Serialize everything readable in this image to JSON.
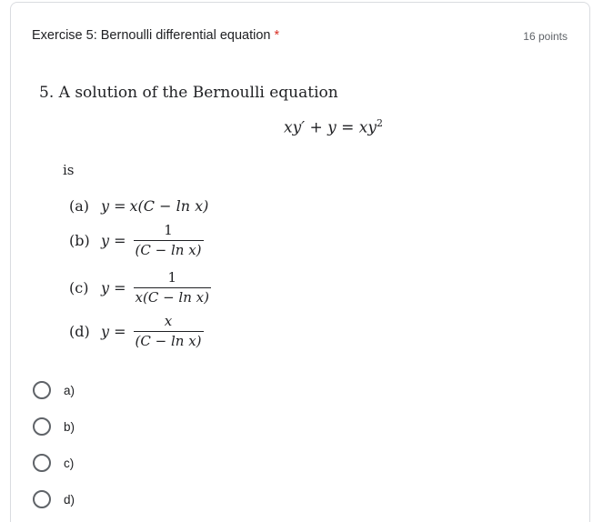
{
  "header": {
    "title": "Exercise 5: Bernoulli differential equation",
    "required_marker": "*",
    "points": "16 points"
  },
  "question": {
    "number": "5.",
    "text": "A solution of the Bernoulli equation",
    "equation_lhs": "xy′ + y = xy",
    "equation_exp": "2",
    "connector": "is"
  },
  "options_math": [
    {
      "label": "(a)",
      "y": "y =",
      "expr": "x(C − ln x)"
    },
    {
      "label": "(b)",
      "y": "y =",
      "num": "1",
      "den": "(C − ln x)"
    },
    {
      "label": "(c)",
      "y": "y =",
      "num": "1",
      "den": "x(C − ln x)"
    },
    {
      "label": "(d)",
      "y": "y =",
      "num": "x",
      "den": "(C − ln x)"
    }
  ],
  "choices": [
    {
      "label": "a)"
    },
    {
      "label": "b)"
    },
    {
      "label": "c)"
    },
    {
      "label": "d)"
    }
  ]
}
